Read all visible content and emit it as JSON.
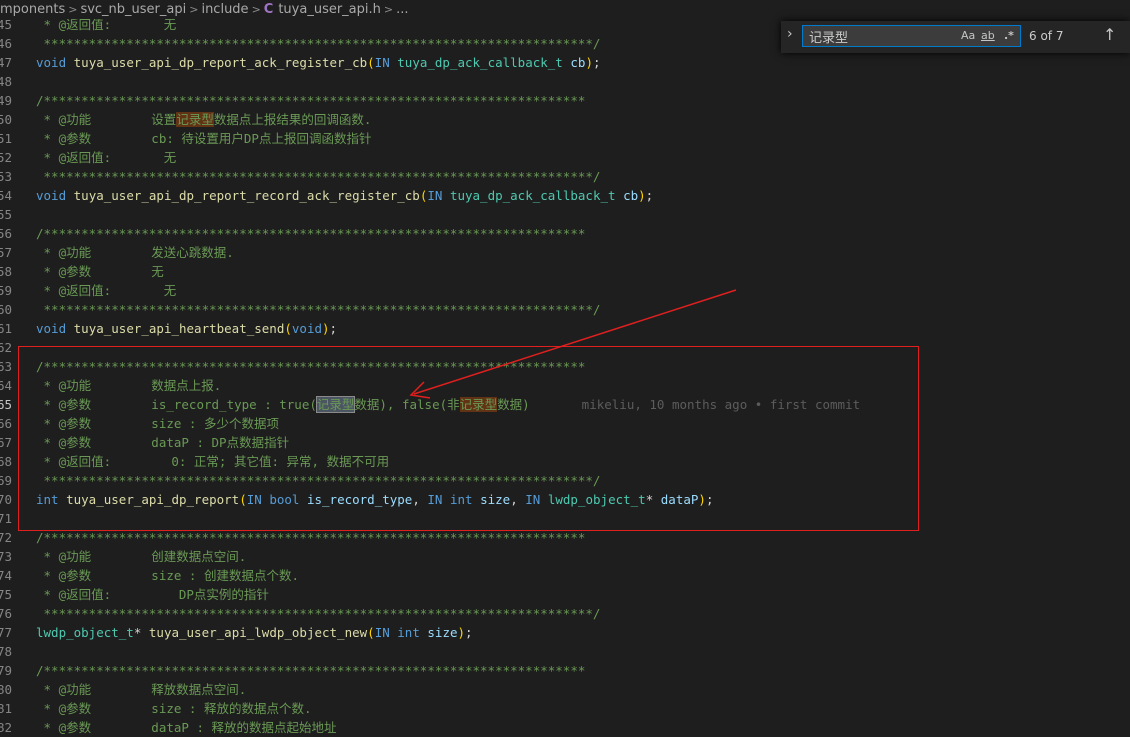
{
  "breadcrumb": {
    "items": [
      "mponents",
      "svc_nb_user_api",
      "include"
    ],
    "file": "tuya_user_api.h",
    "more": "...",
    "file_icon": "C",
    "separator": ">"
  },
  "find": {
    "toggle_icon": "chevron-right-icon",
    "toggle_glyph": "›",
    "query": "记录型",
    "match_case": "Aa",
    "whole_word": "ab",
    "regex": ".*",
    "count": "6 of 7",
    "prev_glyph": "↑"
  },
  "blame": "mikeliu, 10 months ago • first commit",
  "lines": [
    {
      "n": "45",
      "spans": [
        [
          "cm",
          " * @返回值:       无"
        ]
      ]
    },
    {
      "n": "46",
      "spans": [
        [
          "cm",
          " *************************************************************************/"
        ]
      ]
    },
    {
      "n": "47",
      "spans": [
        [
          "kw",
          "void"
        ],
        [
          "pu",
          " "
        ],
        [
          "fn",
          "tuya_user_api_dp_report_ack_register_cb"
        ],
        [
          "pa1",
          "("
        ],
        [
          "kw",
          "IN"
        ],
        [
          "pu",
          " "
        ],
        [
          "ty",
          "tuya_dp_ack_callback_t"
        ],
        [
          "pu",
          " "
        ],
        [
          "vr",
          "cb"
        ],
        [
          "pa1",
          ")"
        ],
        [
          "pu",
          ";"
        ]
      ]
    },
    {
      "n": "48",
      "spans": []
    },
    {
      "n": "49",
      "spans": [
        [
          "cm",
          "/************************************************************************"
        ]
      ]
    },
    {
      "n": "50",
      "spans": [
        [
          "cm",
          " * @功能        设置"
        ],
        [
          "cm hl",
          "记录型"
        ],
        [
          "cm",
          "数据点上报结果的回调函数."
        ]
      ]
    },
    {
      "n": "51",
      "spans": [
        [
          "cm",
          " * @参数        cb: 待设置用户DP点上报回调函数指针"
        ]
      ]
    },
    {
      "n": "52",
      "spans": [
        [
          "cm",
          " * @返回值:       无"
        ]
      ]
    },
    {
      "n": "53",
      "spans": [
        [
          "cm",
          " *************************************************************************/"
        ]
      ]
    },
    {
      "n": "54",
      "spans": [
        [
          "kw",
          "void"
        ],
        [
          "pu",
          " "
        ],
        [
          "fn",
          "tuya_user_api_dp_report_record_ack_register_cb"
        ],
        [
          "pa1",
          "("
        ],
        [
          "kw",
          "IN"
        ],
        [
          "pu",
          " "
        ],
        [
          "ty",
          "tuya_dp_ack_callback_t"
        ],
        [
          "pu",
          " "
        ],
        [
          "vr",
          "cb"
        ],
        [
          "pa1",
          ")"
        ],
        [
          "pu",
          ";"
        ]
      ]
    },
    {
      "n": "55",
      "spans": []
    },
    {
      "n": "56",
      "spans": [
        [
          "cm",
          "/************************************************************************"
        ]
      ]
    },
    {
      "n": "57",
      "spans": [
        [
          "cm",
          " * @功能        发送心跳数据."
        ]
      ]
    },
    {
      "n": "58",
      "spans": [
        [
          "cm",
          " * @参数        无"
        ]
      ]
    },
    {
      "n": "59",
      "spans": [
        [
          "cm",
          " * @返回值:       无"
        ]
      ]
    },
    {
      "n": "60",
      "spans": [
        [
          "cm",
          " *************************************************************************/"
        ]
      ]
    },
    {
      "n": "61",
      "spans": [
        [
          "kw",
          "void"
        ],
        [
          "pu",
          " "
        ],
        [
          "fn",
          "tuya_user_api_heartbeat_send"
        ],
        [
          "pa1",
          "("
        ],
        [
          "kw",
          "void"
        ],
        [
          "pa1",
          ")"
        ],
        [
          "pu",
          ";"
        ]
      ]
    },
    {
      "n": "62",
      "spans": []
    },
    {
      "n": "63",
      "spans": [
        [
          "cm",
          "/************************************************************************"
        ]
      ]
    },
    {
      "n": "64",
      "spans": [
        [
          "cm",
          " * @功能        数据点上报."
        ]
      ]
    },
    {
      "n": "65",
      "active": true,
      "blame": true,
      "spans": [
        [
          "cm",
          " * @参数        is_record_type : true("
        ],
        [
          "cm hlcur",
          "记录型"
        ],
        [
          "cm",
          "数据), false(非"
        ],
        [
          "cm hl",
          "记录型"
        ],
        [
          "cm",
          "数据)"
        ]
      ]
    },
    {
      "n": "66",
      "spans": [
        [
          "cm",
          " * @参数        size : 多少个数据项"
        ]
      ]
    },
    {
      "n": "67",
      "spans": [
        [
          "cm",
          " * @参数        dataP : DP点数据指针"
        ]
      ]
    },
    {
      "n": "68",
      "spans": [
        [
          "cm",
          " * @返回值:        0: 正常; 其它值: 异常, 数据不可用"
        ]
      ]
    },
    {
      "n": "69",
      "spans": [
        [
          "cm",
          " *************************************************************************/"
        ]
      ]
    },
    {
      "n": "70",
      "spans": [
        [
          "kw",
          "int"
        ],
        [
          "pu",
          " "
        ],
        [
          "fn",
          "tuya_user_api_dp_report"
        ],
        [
          "pa1",
          "("
        ],
        [
          "kw",
          "IN"
        ],
        [
          "pu",
          " "
        ],
        [
          "kw",
          "bool"
        ],
        [
          "pu",
          " "
        ],
        [
          "vr",
          "is_record_type"
        ],
        [
          "pu",
          ", "
        ],
        [
          "kw",
          "IN"
        ],
        [
          "pu",
          " "
        ],
        [
          "kw",
          "int"
        ],
        [
          "pu",
          " "
        ],
        [
          "vr",
          "size"
        ],
        [
          "pu",
          ", "
        ],
        [
          "kw",
          "IN"
        ],
        [
          "pu",
          " "
        ],
        [
          "ty",
          "lwdp_object_t"
        ],
        [
          "pu",
          "* "
        ],
        [
          "vr",
          "dataP"
        ],
        [
          "pa1",
          ")"
        ],
        [
          "pu",
          ";"
        ]
      ]
    },
    {
      "n": "71",
      "spans": []
    },
    {
      "n": "72",
      "spans": [
        [
          "cm",
          "/************************************************************************"
        ]
      ]
    },
    {
      "n": "73",
      "spans": [
        [
          "cm",
          " * @功能        创建数据点空间."
        ]
      ]
    },
    {
      "n": "74",
      "spans": [
        [
          "cm",
          " * @参数        size : 创建数据点个数."
        ]
      ]
    },
    {
      "n": "75",
      "spans": [
        [
          "cm",
          " * @返回值:         DP点实例的指针"
        ]
      ]
    },
    {
      "n": "76",
      "spans": [
        [
          "cm",
          " *************************************************************************/"
        ]
      ]
    },
    {
      "n": "77",
      "spans": [
        [
          "ty",
          "lwdp_object_t"
        ],
        [
          "pu",
          "* "
        ],
        [
          "fn",
          "tuya_user_api_lwdp_object_new"
        ],
        [
          "pa1",
          "("
        ],
        [
          "kw",
          "IN"
        ],
        [
          "pu",
          " "
        ],
        [
          "kw",
          "int"
        ],
        [
          "pu",
          " "
        ],
        [
          "vr",
          "size"
        ],
        [
          "pa1",
          ")"
        ],
        [
          "pu",
          ";"
        ]
      ]
    },
    {
      "n": "78",
      "spans": []
    },
    {
      "n": "79",
      "spans": [
        [
          "cm",
          "/************************************************************************"
        ]
      ]
    },
    {
      "n": "80",
      "spans": [
        [
          "cm",
          " * @功能        释放数据点空间."
        ]
      ]
    },
    {
      "n": "81",
      "spans": [
        [
          "cm",
          " * @参数        size : 释放的数据点个数."
        ]
      ]
    },
    {
      "n": "82",
      "spans": [
        [
          "cm",
          " * @参数        dataP : 释放的数据点起始地址"
        ]
      ]
    }
  ],
  "colors": {
    "background": "#1e1e1e",
    "annotation_red": "#e0201f",
    "find_border": "#007acc"
  }
}
